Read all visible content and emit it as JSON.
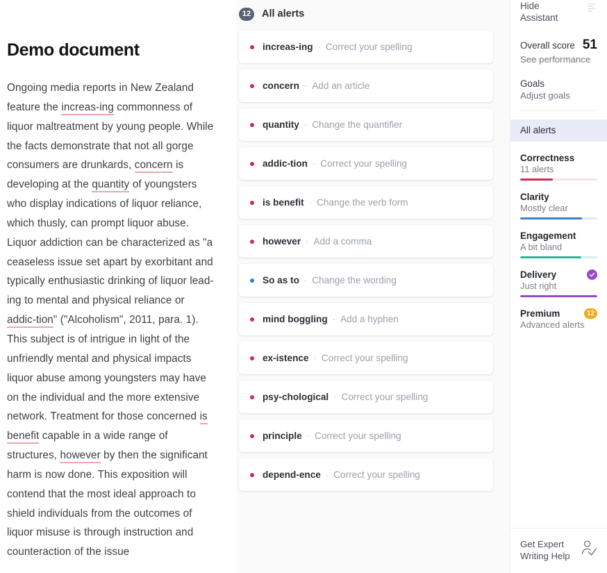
{
  "document": {
    "title": "Demo document",
    "paragraph_runs": [
      {
        "t": "Ongoing media reports in New Zealand feature the ",
        "hl": false
      },
      {
        "t": "increas-ing",
        "hl": true
      },
      {
        "t": " commonness of liquor maltreatment by young people. While the facts demonstrate that not all gorge consumers are drunkards, ",
        "hl": false
      },
      {
        "t": "concern",
        "hl": true
      },
      {
        "t": " is developing at the ",
        "hl": false
      },
      {
        "t": "quantity",
        "hl": true
      },
      {
        "t": " of youngsters who display indications of liquor reliance, which thusly, can prompt liquor abuse. Liquor addiction can be characterized as \"a ceaseless issue set apart by exorbitant and typically enthusiastic drinking of liquor lead-ing to mental and physical reliance or ",
        "hl": false
      },
      {
        "t": "addic-tion",
        "hl": true
      },
      {
        "t": "\" (\"Alcoholism\", 2011, para. 1). This subject is of intrigue in light of the unfriendly mental and physical impacts liquor abuse among youngsters may have on the individual and the more extensive network. Treatment for those concerned ",
        "hl": false
      },
      {
        "t": "is benefit",
        "hl": true
      },
      {
        "t": " capable in a wide range of structures, ",
        "hl": false
      },
      {
        "t": "however",
        "hl": true
      },
      {
        "t": " by then the significant harm is now done. This exposition will contend that the most ideal approach to shield individuals from the outcomes of liquor misuse is through instruction and counteraction of the issue",
        "hl": false
      }
    ]
  },
  "alerts_panel": {
    "count": "12",
    "title": "All alerts",
    "separator": "·",
    "items": [
      {
        "word": "increas-ing",
        "action": "Correct your spelling",
        "severity": "red"
      },
      {
        "word": "concern",
        "action": "Add an article",
        "severity": "red"
      },
      {
        "word": "quantity",
        "action": "Change the quantifier",
        "severity": "red"
      },
      {
        "word": "addic-tion",
        "action": "Correct your spelling",
        "severity": "red"
      },
      {
        "word": "is benefit",
        "action": "Change the verb form",
        "severity": "red"
      },
      {
        "word": "however",
        "action": "Add a comma",
        "severity": "red"
      },
      {
        "word": "So as to",
        "action": "Change the wording",
        "severity": "blue"
      },
      {
        "word": "mind boggling",
        "action": "Add a hyphen",
        "severity": "red"
      },
      {
        "word": "ex-istence",
        "action": "Correct your spelling",
        "severity": "red"
      },
      {
        "word": "psy-chological",
        "action": "Correct your spelling",
        "severity": "red"
      },
      {
        "word": "principle",
        "action": "Correct your spelling",
        "severity": "red"
      },
      {
        "word": "depend-ence",
        "action": "Correct your spelling",
        "severity": "red"
      }
    ]
  },
  "sidebar": {
    "hide_assistant": "Hide\nAssistant",
    "hide_assistant_line1": "Hide",
    "hide_assistant_line2": "Assistant",
    "overall_score_label": "Overall score",
    "overall_score_value": "51",
    "see_performance": "See performance",
    "goals_title": "Goals",
    "goals_sub": "Adjust goals",
    "all_alerts": "All alerts",
    "metrics": [
      {
        "name": "Correctness",
        "sub": "11 alerts",
        "fill": 42,
        "color": "#c9304f",
        "track": "#f6dfe3",
        "badge": "none"
      },
      {
        "name": "Clarity",
        "sub": "Mostly clear",
        "fill": 80,
        "color": "#3c7ec7",
        "track": "#dbe7f5",
        "badge": "none"
      },
      {
        "name": "Engagement",
        "sub": "A bit bland",
        "fill": 79,
        "color": "#2bb396",
        "track": "#d3f0e9",
        "badge": "none"
      },
      {
        "name": "Delivery",
        "sub": "Just right",
        "fill": 100,
        "color": "#9c46c8",
        "track": "#e7d9f1",
        "badge": "check"
      },
      {
        "name": "Premium",
        "sub": "Advanced alerts",
        "fill": 0,
        "color": "#f3a81a",
        "track": "#ffffff",
        "badge": "premium",
        "badge_text": "12"
      }
    ],
    "expert_line1": "Get Expert",
    "expert_line2": "Writing Help"
  }
}
